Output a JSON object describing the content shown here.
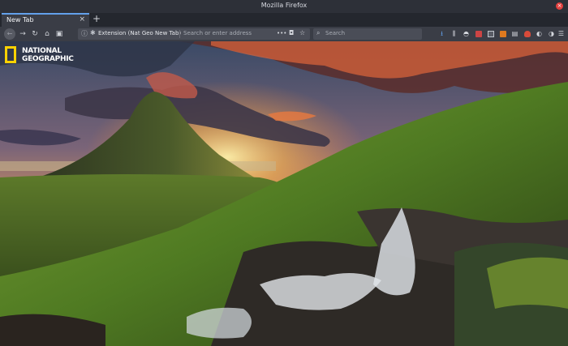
{
  "window": {
    "title": "Mozilla Firefox",
    "close_icon": "close-icon"
  },
  "tabs": [
    {
      "label": "New Tab",
      "active": true
    }
  ],
  "tab_close_glyph": "×",
  "new_tab_glyph": "+",
  "urlbar": {
    "identity_label": "Extension (Nat Geo New Tab)",
    "placeholder": "Search or enter address",
    "page_actions_glyph": "•••"
  },
  "searchbar": {
    "placeholder": "Search"
  },
  "content": {
    "logo_line1": "NATIONAL",
    "logo_line2": "GEOGRAPHIC"
  },
  "colors": {
    "accent": "#62a0ea",
    "natgeo_yellow": "#ffd200",
    "close_red": "#e3413f"
  }
}
